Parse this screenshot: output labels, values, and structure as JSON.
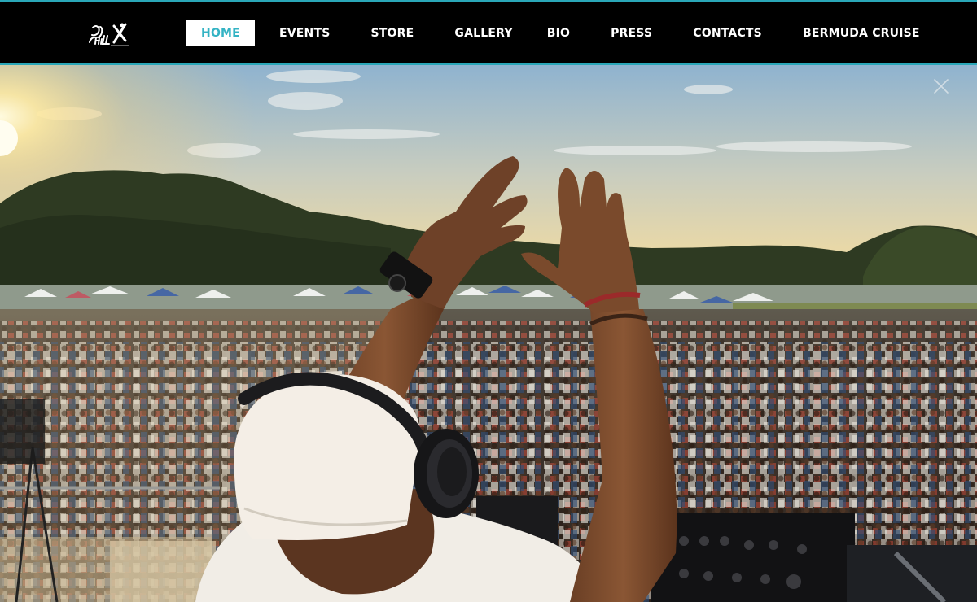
{
  "header": {
    "logo_text": "DJ CHILL X",
    "nav": [
      {
        "label": "HOME",
        "active": true
      },
      {
        "label": "EVENTS",
        "active": false
      },
      {
        "label": "STORE",
        "active": false
      },
      {
        "label": "GALLERY",
        "active": false
      },
      {
        "label": "BIO",
        "active": false
      },
      {
        "label": "PRESS",
        "active": false
      },
      {
        "label": "CONTACTS",
        "active": false
      },
      {
        "label": "BERMUDA CRUISE",
        "active": false
      }
    ]
  },
  "hero": {
    "image_alt": "DJ on stage raising hands before a large outdoor festival crowd at sunset",
    "close_icon": "close-icon"
  },
  "colors": {
    "accent": "#34b3c4",
    "header_bg": "#000000",
    "header_border": "#2aa7b8"
  }
}
